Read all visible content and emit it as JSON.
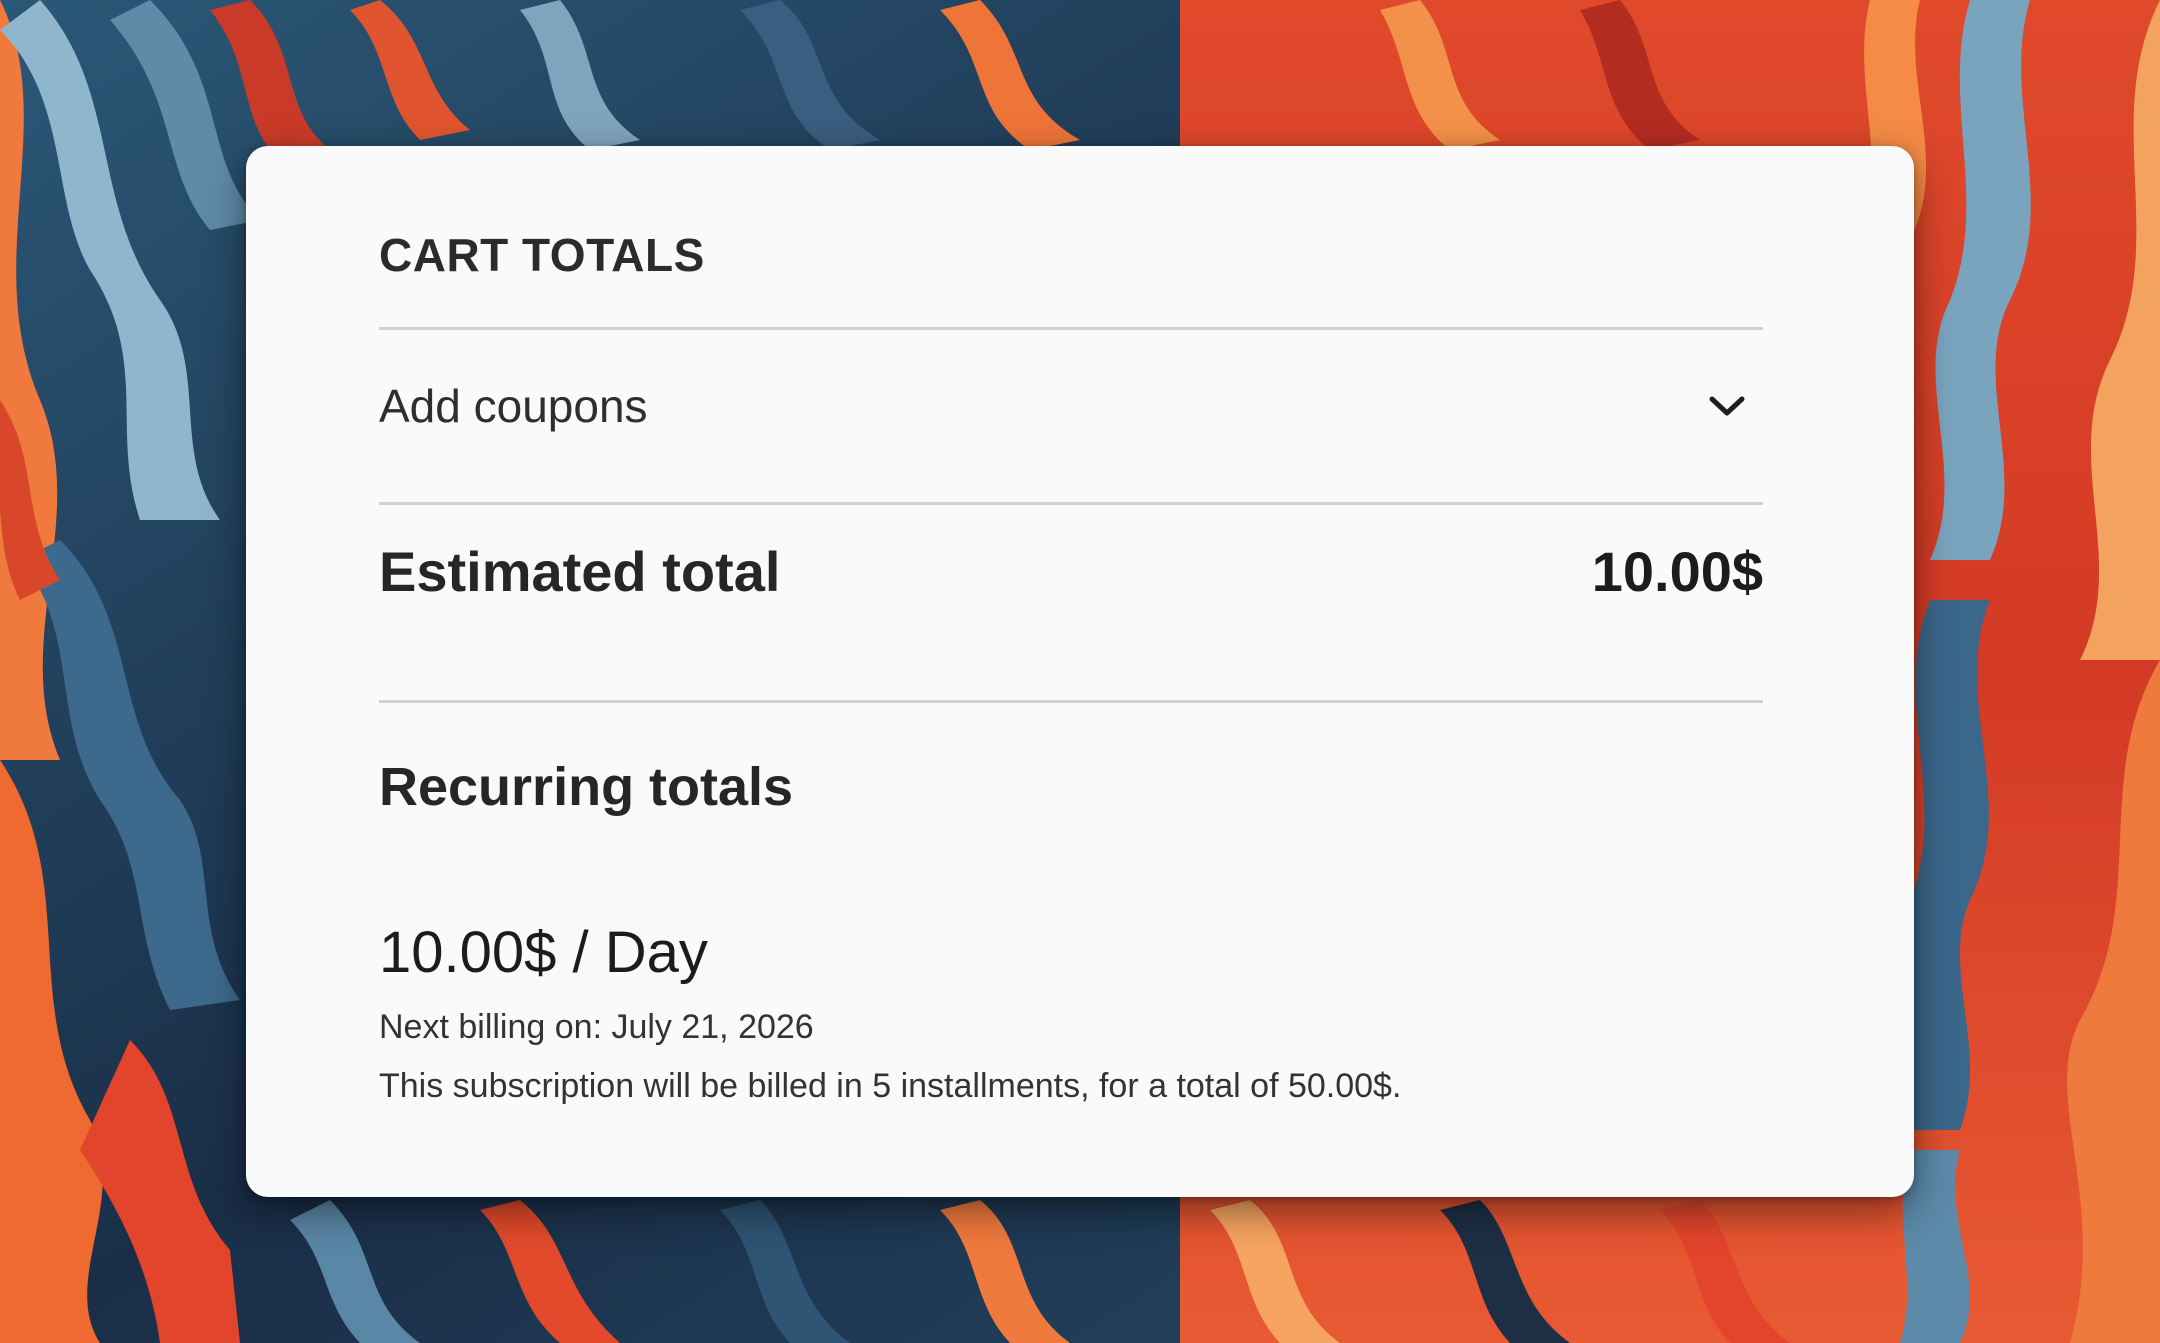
{
  "colors": {
    "card_background": "#fafafa",
    "text": "#1e1e1e",
    "divider": "#d2d2d2",
    "background_orange": "#e2452c",
    "background_blue": "#2c4e6c"
  },
  "cart_totals": {
    "heading": "CART TOTALS",
    "coupon": {
      "label": "Add coupons",
      "icon": "chevron-down-icon"
    },
    "estimated_total": {
      "label": "Estimated total",
      "value": "10.00$"
    },
    "recurring": {
      "title": "Recurring totals",
      "price": "10.00$ / Day",
      "next_billing": "Next billing on: July 21, 2026",
      "installments_note": "This subscription will be billed in 5 installments, for a total of 50.00$."
    }
  }
}
